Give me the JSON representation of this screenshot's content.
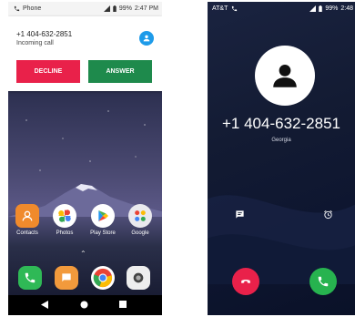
{
  "left_phone": {
    "status_bar": {
      "app": "Phone",
      "battery": "99%",
      "time": "2:47 PM"
    },
    "notification": {
      "number": "+1 404-632-2851",
      "subtitle": "Incoming call",
      "decline_label": "DECLINE",
      "answer_label": "ANSWER"
    },
    "apps": [
      "Contacts",
      "Photos",
      "Play Store",
      "Google"
    ],
    "colors": {
      "decline": "#e9214a",
      "answer": "#1e8a4c",
      "avatar": "#1e9be9"
    }
  },
  "right_phone": {
    "status_bar": {
      "carrier": "AT&T",
      "battery": "99%",
      "time": "2:48"
    },
    "caller_number": "+1 404-632-2851",
    "caller_location": "Georgia",
    "colors": {
      "end": "#e9214a",
      "accept": "#27b34f"
    }
  }
}
